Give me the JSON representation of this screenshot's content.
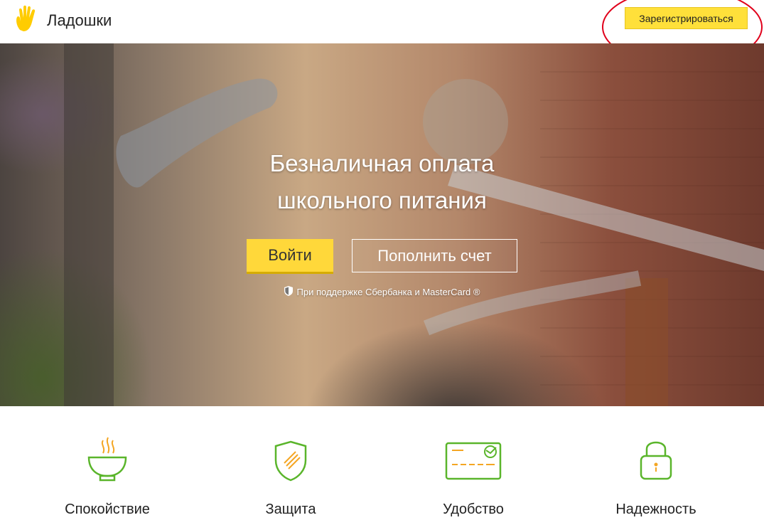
{
  "header": {
    "logo_text": "Ладошки",
    "register_label": "Зарегистрироваться"
  },
  "hero": {
    "title_line1": "Безналичная оплата",
    "title_line2": "школьного питания",
    "login_label": "Войти",
    "topup_label": "Пополнить счет",
    "support_text": "При поддержке Сбербанка и MasterCard ®"
  },
  "features": [
    {
      "label": "Спокойствие",
      "icon": "bowl-icon"
    },
    {
      "label": "Защита",
      "icon": "shield-icon"
    },
    {
      "label": "Удобство",
      "icon": "card-icon"
    },
    {
      "label": "Надежность",
      "icon": "lock-icon"
    }
  ],
  "colors": {
    "accent_yellow": "#ffd83a",
    "feature_green": "#5ab52b",
    "feature_orange": "#f4a623",
    "annotation_red": "#e0001b"
  }
}
